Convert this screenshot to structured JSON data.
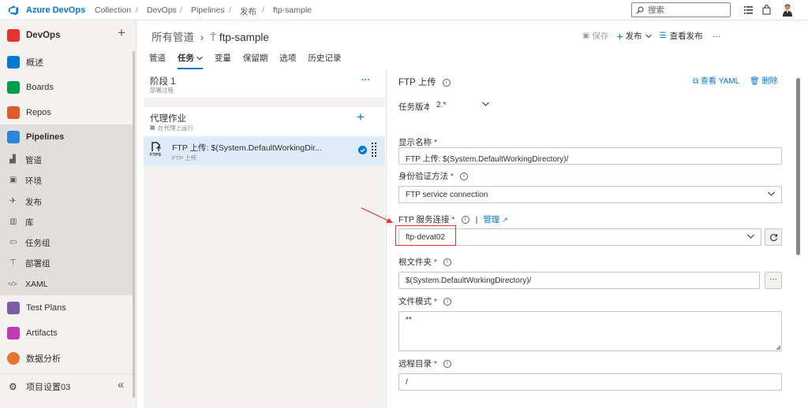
{
  "topbar": {
    "brand": "Azure DevOps",
    "breadcrumb": [
      "Collection",
      "DevOps",
      "Pipelines",
      "发布",
      "ftp-sample"
    ],
    "search_placeholder": "搜索"
  },
  "leftnav": {
    "project": "DevOps",
    "items": [
      {
        "label": "概述",
        "icon": "overview-icon",
        "color": "#0078d4"
      },
      {
        "label": "Boards",
        "icon": "boards-icon",
        "color": "#009e49"
      },
      {
        "label": "Repos",
        "icon": "repos-icon",
        "color": "#e05b2a"
      },
      {
        "label": "Pipelines",
        "icon": "pipelines-icon",
        "color": "#2b88d8"
      }
    ],
    "sub_items": [
      "管道",
      "环境",
      "发布",
      "库",
      "任务组",
      "部署组",
      "XAML"
    ],
    "bottom_items": [
      {
        "label": "Test Plans",
        "icon": "test-plans-icon",
        "color": "#7b5ea7"
      },
      {
        "label": "Artifacts",
        "icon": "artifacts-icon",
        "color": "#c239b3"
      },
      {
        "label": "数据分析",
        "icon": "analytics-icon",
        "color": "#e8732f"
      }
    ],
    "settings": "项目设置03"
  },
  "header": {
    "parent": "所有管道",
    "title": "ftp-sample",
    "save": "保存",
    "release": "发布",
    "view_releases": "查看发布",
    "more": "···",
    "tabs": [
      "管道",
      "任务",
      "变量",
      "保留期",
      "选项",
      "历史记录"
    ],
    "active_tab": "任务"
  },
  "middle": {
    "stage_title": "阶段 1",
    "stage_sub": "部署过程",
    "stage_more": "···",
    "agent_job": "代理作业",
    "agent_sub": "在代理上运行",
    "task_title": "FTP 上传: $(System.DefaultWorkingDir...",
    "task_sub": "FTP 上传",
    "task_icon_text": "FTPS"
  },
  "right": {
    "title": "FTP 上传",
    "view_yaml": "查看 YAML",
    "delete": "删除",
    "version_label": "任务版本",
    "version_value": "2.*",
    "display_name_label": "显示名称",
    "display_name_value": "FTP 上传: $(System.DefaultWorkingDirectory)/",
    "auth_label": "身份验证方法",
    "auth_value": "FTP service connection",
    "ftp_conn_label": "FTP 服务连接",
    "manage": "管理",
    "ftp_conn_value": "ftp-devat02",
    "root_label": "根文件夹",
    "root_value": "$(System.DefaultWorkingDirectory)/",
    "pattern_label": "文件模式",
    "pattern_value": "**",
    "remote_label": "远程目录",
    "remote_value": "/",
    "required_mark": "*",
    "browse": "···"
  },
  "colors": {
    "accent": "#0078d4",
    "highlight": "#e8322e"
  }
}
